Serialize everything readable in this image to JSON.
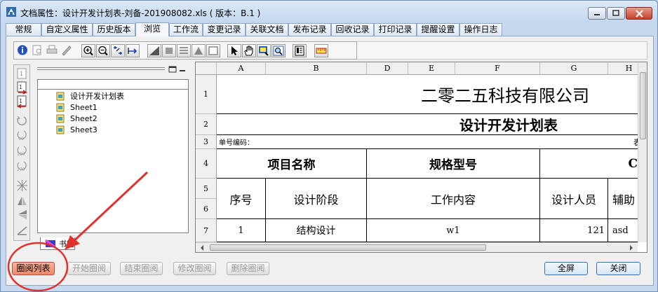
{
  "window": {
    "title": "文档属性：设计开发计划表-刘备-201908082.xls ( 版本：B.1 )"
  },
  "tabs": [
    {
      "label": "常规"
    },
    {
      "label": "自定义属性"
    },
    {
      "label": "历史版本"
    },
    {
      "label": "浏览",
      "active": true
    },
    {
      "label": "工作流"
    },
    {
      "label": "变更记录"
    },
    {
      "label": "关联文档"
    },
    {
      "label": "发布记录"
    },
    {
      "label": "回收记录"
    },
    {
      "label": "打印记录"
    },
    {
      "label": "提醒设置"
    },
    {
      "label": "操作日志"
    }
  ],
  "tree": {
    "items": [
      {
        "label": "设计开发计划表"
      },
      {
        "label": "Sheet1"
      },
      {
        "label": "Sheet2"
      },
      {
        "label": "Sheet3"
      }
    ],
    "tab_label": "书签"
  },
  "sheet": {
    "columns": [
      "A",
      "B",
      "D",
      "E",
      "F",
      "G",
      "H"
    ],
    "rows": [
      "1",
      "2",
      "3",
      "4",
      "5",
      "6",
      "7"
    ],
    "company": "二零二五科技有限公司",
    "doc_title": "设计开发计划表",
    "doc_no_label": "单号编码：",
    "row3_right": "表",
    "header_project_name": "项目名称",
    "header_spec_model": "规格型号",
    "header_ca": "Ca",
    "header_seq": "序号",
    "header_design_stage": "设计阶段",
    "header_work_content": "工作内容",
    "header_designer": "设计人员",
    "header_assist": "辅助",
    "row7_seq": "1",
    "row7_stage": "结构设计",
    "row7_content": "w1",
    "row7_designer": "121",
    "row7_assist": "asd"
  },
  "buttons": {
    "circle_list": "圈阅列表",
    "start_circle": "开始圈阅",
    "end_circle": "结束圈阅",
    "modify_circle": "修改圈阅",
    "delete_circle": "删除圈阅",
    "fullscreen": "全屏",
    "close": "关闭"
  },
  "colors": {
    "annotation": "#e0312b",
    "active_button": "#ef8868"
  }
}
